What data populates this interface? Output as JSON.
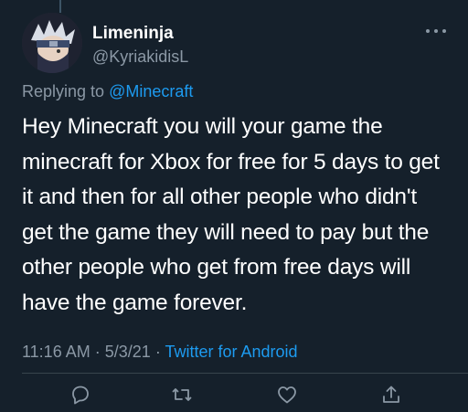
{
  "tweet": {
    "author_name": "Limeninja",
    "author_handle": "@KyriakidisL",
    "reply_prefix": "Replying to",
    "reply_mention": "@Minecraft",
    "text": "Hey Minecraft you will your game the minecraft for Xbox for free for 5 days to get it and then for all other people who didn't get the game they will need to pay but the other people who get from free days will have the game forever.",
    "time": "11:16 AM",
    "separator": "·",
    "date": "5/3/21",
    "source": "Twitter for Android"
  },
  "actions": {
    "reply_icon": "reply-icon",
    "retweet_icon": "retweet-icon",
    "like_icon": "heart-icon",
    "share_icon": "share-icon"
  },
  "colors": {
    "background": "#15202b",
    "accent": "#1d9bf0",
    "secondary_text": "#8b98a5"
  }
}
